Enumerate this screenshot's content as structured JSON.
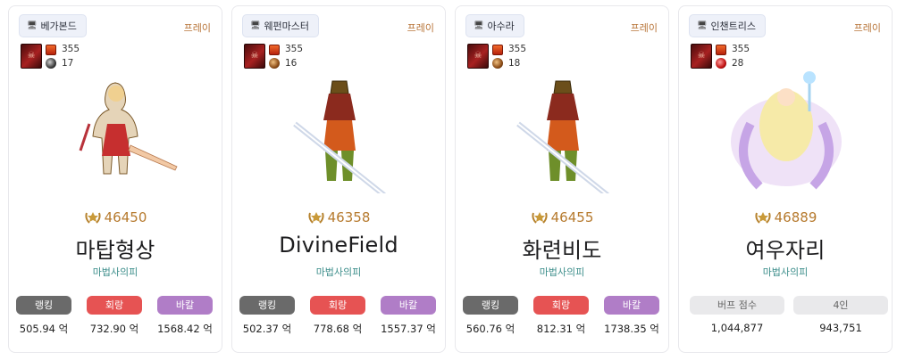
{
  "cards": [
    {
      "server": "베가본드",
      "tag": "프레이",
      "stat_top": "355",
      "stat_bottom": "17",
      "score": "46450",
      "name": "마탑형상",
      "job": "마법사의피",
      "stat_labels": [
        "랭킹",
        "회랑",
        "바칼"
      ],
      "stat_values": [
        "505.94 억",
        "732.90 억",
        "1568.42 억"
      ]
    },
    {
      "server": "웨펀마스터",
      "tag": "프레이",
      "stat_top": "355",
      "stat_bottom": "16",
      "score": "46358",
      "name": "DivineField",
      "job": "마법사의피",
      "stat_labels": [
        "랭킹",
        "회랑",
        "바칼"
      ],
      "stat_values": [
        "502.37 억",
        "778.68 억",
        "1557.37 억"
      ]
    },
    {
      "server": "아수라",
      "tag": "프레이",
      "stat_top": "355",
      "stat_bottom": "18",
      "score": "46455",
      "name": "화련비도",
      "job": "마법사의피",
      "stat_labels": [
        "랭킹",
        "회랑",
        "바칼"
      ],
      "stat_values": [
        "560.76 억",
        "812.31 억",
        "1738.35 억"
      ]
    },
    {
      "server": "인챈트리스",
      "tag": "프레이",
      "stat_top": "355",
      "stat_bottom": "28",
      "score": "46889",
      "name": "여우자리",
      "job": "마법사의피",
      "stat_labels": [
        "버프 점수",
        "4인"
      ],
      "stat_values": [
        "1,044,877",
        "943,751"
      ]
    }
  ],
  "icons": {
    "server_icon": "server-icon",
    "laurel_icon": "laurel-icon"
  },
  "colors": {
    "score": "#b67a2e",
    "job": "#3b8d8a",
    "rank_badge": "#6a6a6a",
    "corridor_badge": "#e65353",
    "bakal_badge": "#b07dc7",
    "buff_badge": "#e9e9eb"
  }
}
